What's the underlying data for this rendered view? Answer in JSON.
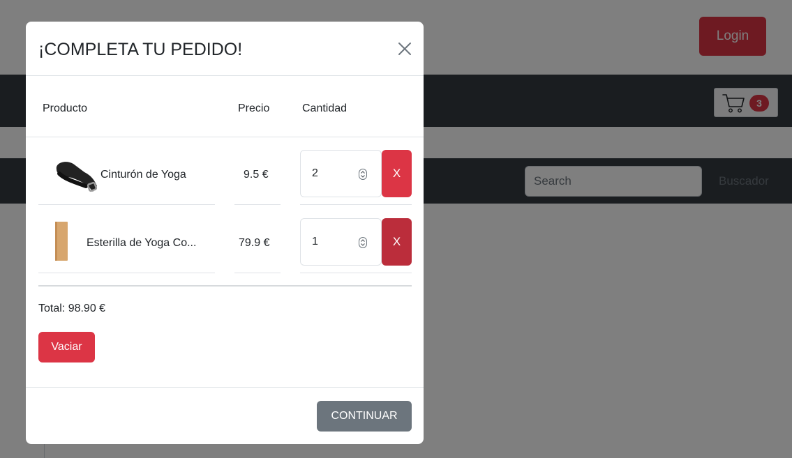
{
  "header": {
    "login_label": "Login"
  },
  "cart": {
    "count": "3"
  },
  "search": {
    "placeholder": "Search",
    "button_label": "Buscador"
  },
  "modal": {
    "title": "¡COMPLETA TU PEDIDO!",
    "columns": {
      "product": "Producto",
      "price": "Precio",
      "quantity": "Cantidad"
    },
    "items": [
      {
        "name": "Cinturón de Yoga",
        "price": "9.5 €",
        "quantity": "2",
        "delete_label": "X",
        "delete_color": "#dc3545"
      },
      {
        "name": "Esterilla de Yoga Co...",
        "price": "79.9 €",
        "quantity": "1",
        "delete_label": "X",
        "delete_color": "#bb2d3b"
      }
    ],
    "total": "Total: 98.90 €",
    "clear_label": "Vaciar",
    "continue_label": "CONTINUAR"
  },
  "colors": {
    "danger": "#dc3545",
    "secondary": "#6c757d",
    "navbar": "#343a40",
    "backdrop": "rgba(0,0,0,0.5)"
  }
}
